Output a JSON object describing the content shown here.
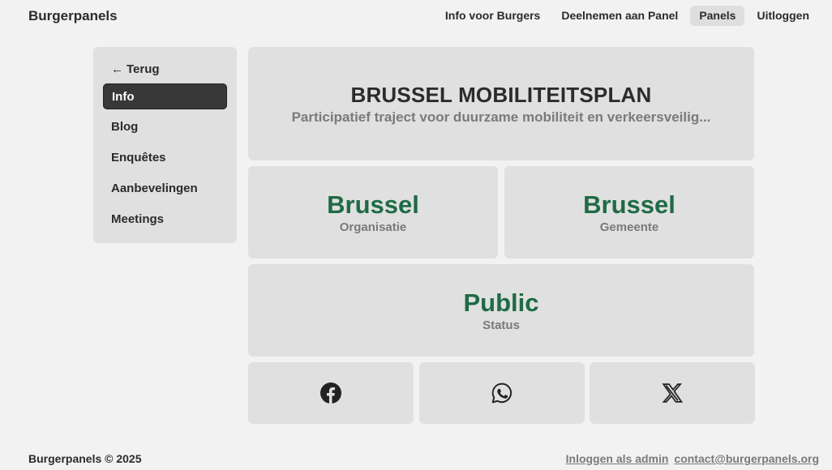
{
  "header": {
    "brand": "Burgerpanels",
    "nav": [
      {
        "label": "Info voor Burgers"
      },
      {
        "label": "Deelnemen aan Panel"
      },
      {
        "label": "Panels",
        "active": true
      },
      {
        "label": "Uitloggen"
      }
    ]
  },
  "sidebar": {
    "back_label": "Terug",
    "items": [
      {
        "label": "Info",
        "active": true
      },
      {
        "label": "Blog"
      },
      {
        "label": "Enquêtes"
      },
      {
        "label": "Aanbevelingen"
      },
      {
        "label": "Meetings"
      }
    ]
  },
  "panel": {
    "title": "BRUSSEL MOBILITEITSPLAN",
    "subtitle": "Participatief traject voor duurzame mobiliteit en verkeersveilig...",
    "stats": {
      "organisation": {
        "value": "Brussel",
        "label": "Organisatie"
      },
      "municipality": {
        "value": "Brussel",
        "label": "Gemeente"
      },
      "status": {
        "value": "Public",
        "label": "Status"
      }
    }
  },
  "share": {
    "icons": [
      "facebook-icon",
      "whatsapp-icon",
      "x-icon"
    ]
  },
  "footer": {
    "copyright": "Burgerpanels © 2025",
    "admin_link": "Inloggen als admin",
    "contact_link": "contact@burgerpanels.org"
  },
  "colors": {
    "accent_green": "#1e6b45",
    "card_bg": "#e0e0e0",
    "page_bg": "#f2f2f2",
    "active_item_bg": "#383838"
  }
}
